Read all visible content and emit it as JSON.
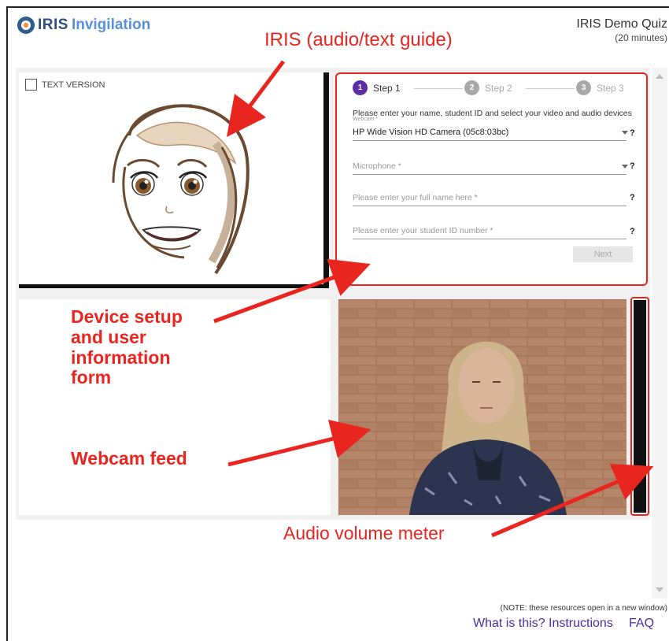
{
  "header": {
    "logo_strong": "IRIS",
    "logo_light": "Invigilation",
    "quiz_title": "IRIS Demo Quiz",
    "quiz_duration": "(20 minutes)"
  },
  "avatar_panel": {
    "text_version_label": "TEXT VERSION"
  },
  "form": {
    "steps": [
      {
        "number": "1",
        "label": "Step 1"
      },
      {
        "number": "2",
        "label": "Step 2"
      },
      {
        "number": "3",
        "label": "Step 3"
      }
    ],
    "instructions": "Please enter your name, student ID and select your video and audio devices",
    "webcam_label": "Webcam *",
    "webcam_value": "HP Wide Vision HD Camera (05c8:03bc)",
    "microphone_placeholder": "Microphone *",
    "name_placeholder": "Please enter your full name here *",
    "student_id_placeholder": "Please enter your student ID number *",
    "help_symbol": "?",
    "next_label": "Next"
  },
  "footer": {
    "note": "(NOTE: these resources open in a new window)",
    "links": [
      "What is this?",
      "Instructions",
      "FAQ"
    ]
  },
  "annotations": {
    "iris_guide": "IRIS (audio/text guide)",
    "device_setup": [
      "Device setup",
      "and user",
      "information",
      "form"
    ],
    "webcam_feed": "Webcam feed",
    "audio_meter": "Audio volume meter"
  },
  "colors": {
    "annotation_red": "#e8261f",
    "step_active": "#5b2ea6",
    "link_purple": "#4b2fa0"
  }
}
